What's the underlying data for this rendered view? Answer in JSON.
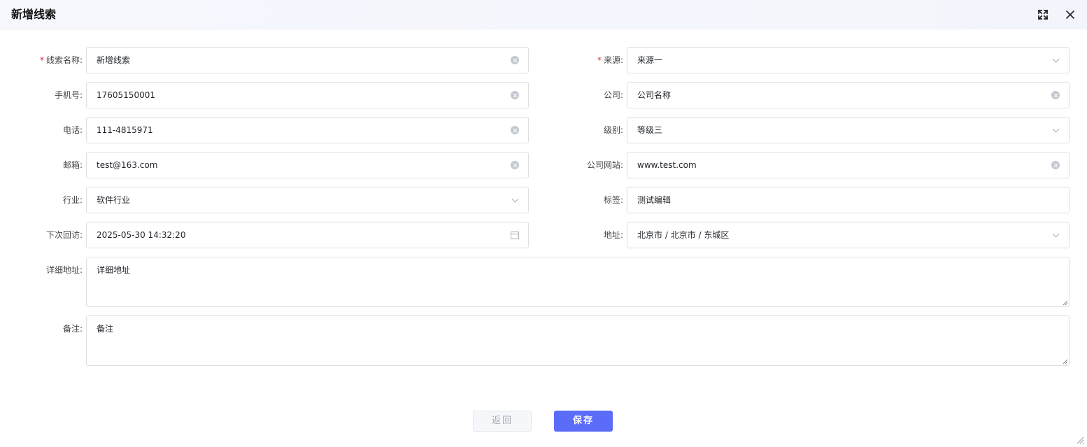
{
  "dialog": {
    "title": "新增线索"
  },
  "form": {
    "clue_name": {
      "label": "线索名称:",
      "value": "新增线索",
      "required": true
    },
    "source": {
      "label": "来源:",
      "value": "来源一",
      "required": true
    },
    "mobile": {
      "label": "手机号:",
      "value": "17605150001"
    },
    "company": {
      "label": "公司:",
      "value": "公司名称"
    },
    "phone": {
      "label": "电话:",
      "value": "111-4815971"
    },
    "level": {
      "label": "级别:",
      "value": "等级三"
    },
    "email": {
      "label": "邮箱:",
      "value": "test@163.com"
    },
    "website": {
      "label": "公司网站:",
      "value": "www.test.com"
    },
    "industry": {
      "label": "行业:",
      "value": "软件行业"
    },
    "tags": {
      "label": "标签:",
      "value": "测试编辑"
    },
    "next_visit": {
      "label": "下次回访:",
      "value": "2025-05-30 14:32:20"
    },
    "address": {
      "label": "地址:",
      "value": "北京市 / 北京市 / 东城区"
    },
    "detail_address": {
      "label": "详细地址:",
      "value": "详细地址"
    },
    "remark": {
      "label": "备注:",
      "value": "备注"
    }
  },
  "footer": {
    "back_label": "返回",
    "save_label": "保存"
  },
  "colors": {
    "primary": "#5b6cf9",
    "required_star": "#e0272d",
    "border": "#dcdfe6"
  }
}
